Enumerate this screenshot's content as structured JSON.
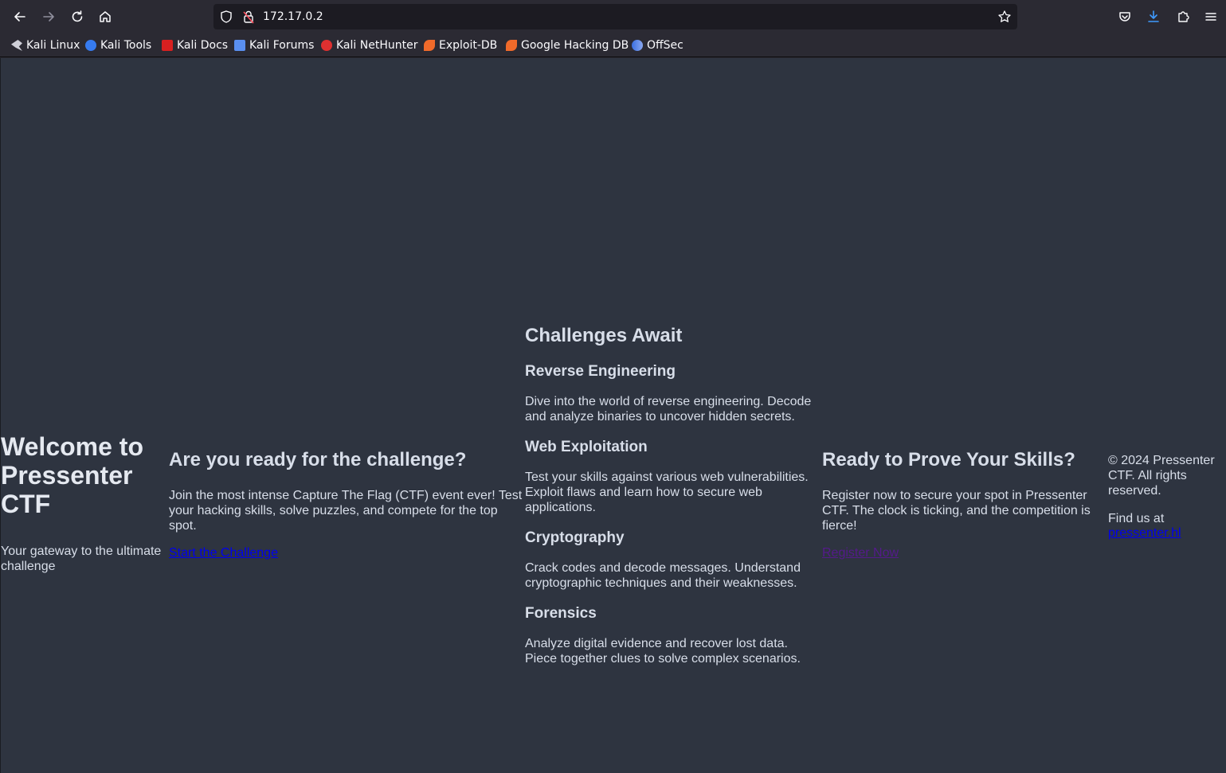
{
  "browser": {
    "url": "172.17.0.2",
    "bookmarks": [
      {
        "label": "Kali Linux",
        "color": "#e6e6e6"
      },
      {
        "label": "Kali Tools",
        "color": "#367bf0"
      },
      {
        "label": "Kali Docs",
        "color": "#e02020"
      },
      {
        "label": "Kali Forums",
        "color": "#5a8ff0"
      },
      {
        "label": "Kali NetHunter",
        "color": "#e03030"
      },
      {
        "label": "Exploit-DB",
        "color": "#f06a2a"
      },
      {
        "label": "Google Hacking DB",
        "color": "#f06a2a"
      },
      {
        "label": "OffSec",
        "color": "#5a7ae0"
      }
    ]
  },
  "page": {
    "hero": {
      "title": "Welcome to Pressenter CTF",
      "subtitle": "Your gateway to the ultimate challenge"
    },
    "intro": {
      "heading": "Are you ready for the challenge?",
      "text": "Join the most intense Capture The Flag (CTF) event ever! Test your hacking skills, solve puzzles, and compete for the top spot.",
      "link": "Start the Challenge"
    },
    "challenges": {
      "heading": "Challenges Await",
      "items": [
        {
          "title": "Reverse Engineering",
          "text": "Dive into the world of reverse engineering. Decode and analyze binaries to uncover hidden secrets."
        },
        {
          "title": "Web Exploitation",
          "text": "Test your skills against various web vulnerabilities. Exploit flaws and learn how to secure web applications."
        },
        {
          "title": "Cryptography",
          "text": "Crack codes and decode messages. Understand cryptographic techniques and their weaknesses."
        },
        {
          "title": "Forensics",
          "text": "Analyze digital evidence and recover lost data. Piece together clues to solve complex scenarios."
        }
      ]
    },
    "register": {
      "heading": "Ready to Prove Your Skills?",
      "text": "Register now to secure your spot in Pressenter CTF. The clock is ticking, and the competition is fierce!",
      "link": "Register Now"
    },
    "footer": {
      "copyright": "© 2024 Pressenter CTF. All rights reserved.",
      "find_us": "Find us at",
      "link": "pressenter.hl"
    }
  }
}
